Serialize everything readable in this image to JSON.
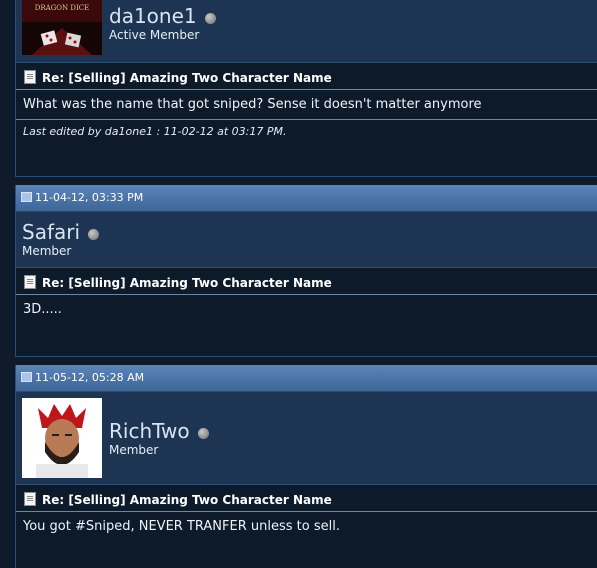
{
  "posts": [
    {
      "username": "da1one1",
      "usertitle": "Active Member",
      "title": "Re: [Selling] Amazing Two Character Name",
      "message": "What was the name that got sniped? Sense it doesn't matter anymore",
      "edited": "Last edited by da1one1 : 11-02-12 at 03:17 PM."
    },
    {
      "date": "11-04-12, 03:33 PM",
      "username": "Safari",
      "usertitle": "Member",
      "title": "Re: [Selling] Amazing Two Character Name",
      "message": "3D....."
    },
    {
      "date": "11-05-12, 05:28 AM",
      "username": "RichTwo",
      "usertitle": "Member",
      "title": "Re: [Selling] Amazing Two Character Name",
      "message": "You got #Sniped, NEVER TRANFER unless to sell."
    }
  ],
  "avatars": {
    "da1one1": {
      "text": "DRAGON DICE"
    }
  },
  "colors": {
    "header_gradient_top": "#5b86b7",
    "header_gradient_bottom": "#3e6698",
    "userbar": "#1d3552",
    "body_bg": "#0d1a2a"
  }
}
